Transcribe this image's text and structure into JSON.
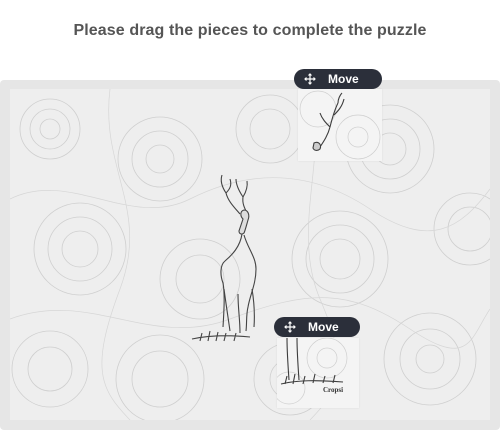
{
  "page": {
    "title": "Please drag the pieces to complete the puzzle"
  },
  "puzzle": {
    "pieces": [
      {
        "handle_label": "Move",
        "content": "antler piece"
      },
      {
        "handle_label": "Move",
        "content": "legs piece",
        "caption": "Cropsi"
      }
    ]
  },
  "icons": {
    "move_handle_icon": "move-arrows-icon"
  },
  "colors": {
    "title_text": "#555555",
    "frame_bg": "#e6e6e6",
    "board_bg": "#eeeeee",
    "handle_bg": "#2b2f3a",
    "handle_text": "#ffffff"
  }
}
